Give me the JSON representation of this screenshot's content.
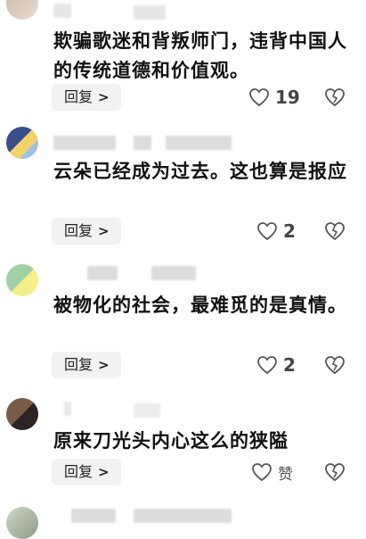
{
  "comments": [
    {
      "text": "欺骗歌迷和背叛师门，违背中国人的传统道德和价值观。",
      "reply_label": "回复",
      "like_count": "19"
    },
    {
      "text": "云朵已经成为过去。这也算是报应",
      "reply_label": "回复",
      "like_count": "2"
    },
    {
      "text": "被物化的社会，最难觅的是真情。",
      "reply_label": "回复",
      "like_count": "2"
    },
    {
      "text": "原来刀光头内心这么的狭隘",
      "reply_label": "回复",
      "like_count": "赞"
    }
  ],
  "colors": {
    "text": "#111111",
    "reply_bg": "#f2f2f2",
    "icon": "#555555"
  },
  "icons": {
    "like": "heart-outline-icon",
    "dislike": "broken-heart-icon",
    "chevron": "chevron-right-icon"
  }
}
